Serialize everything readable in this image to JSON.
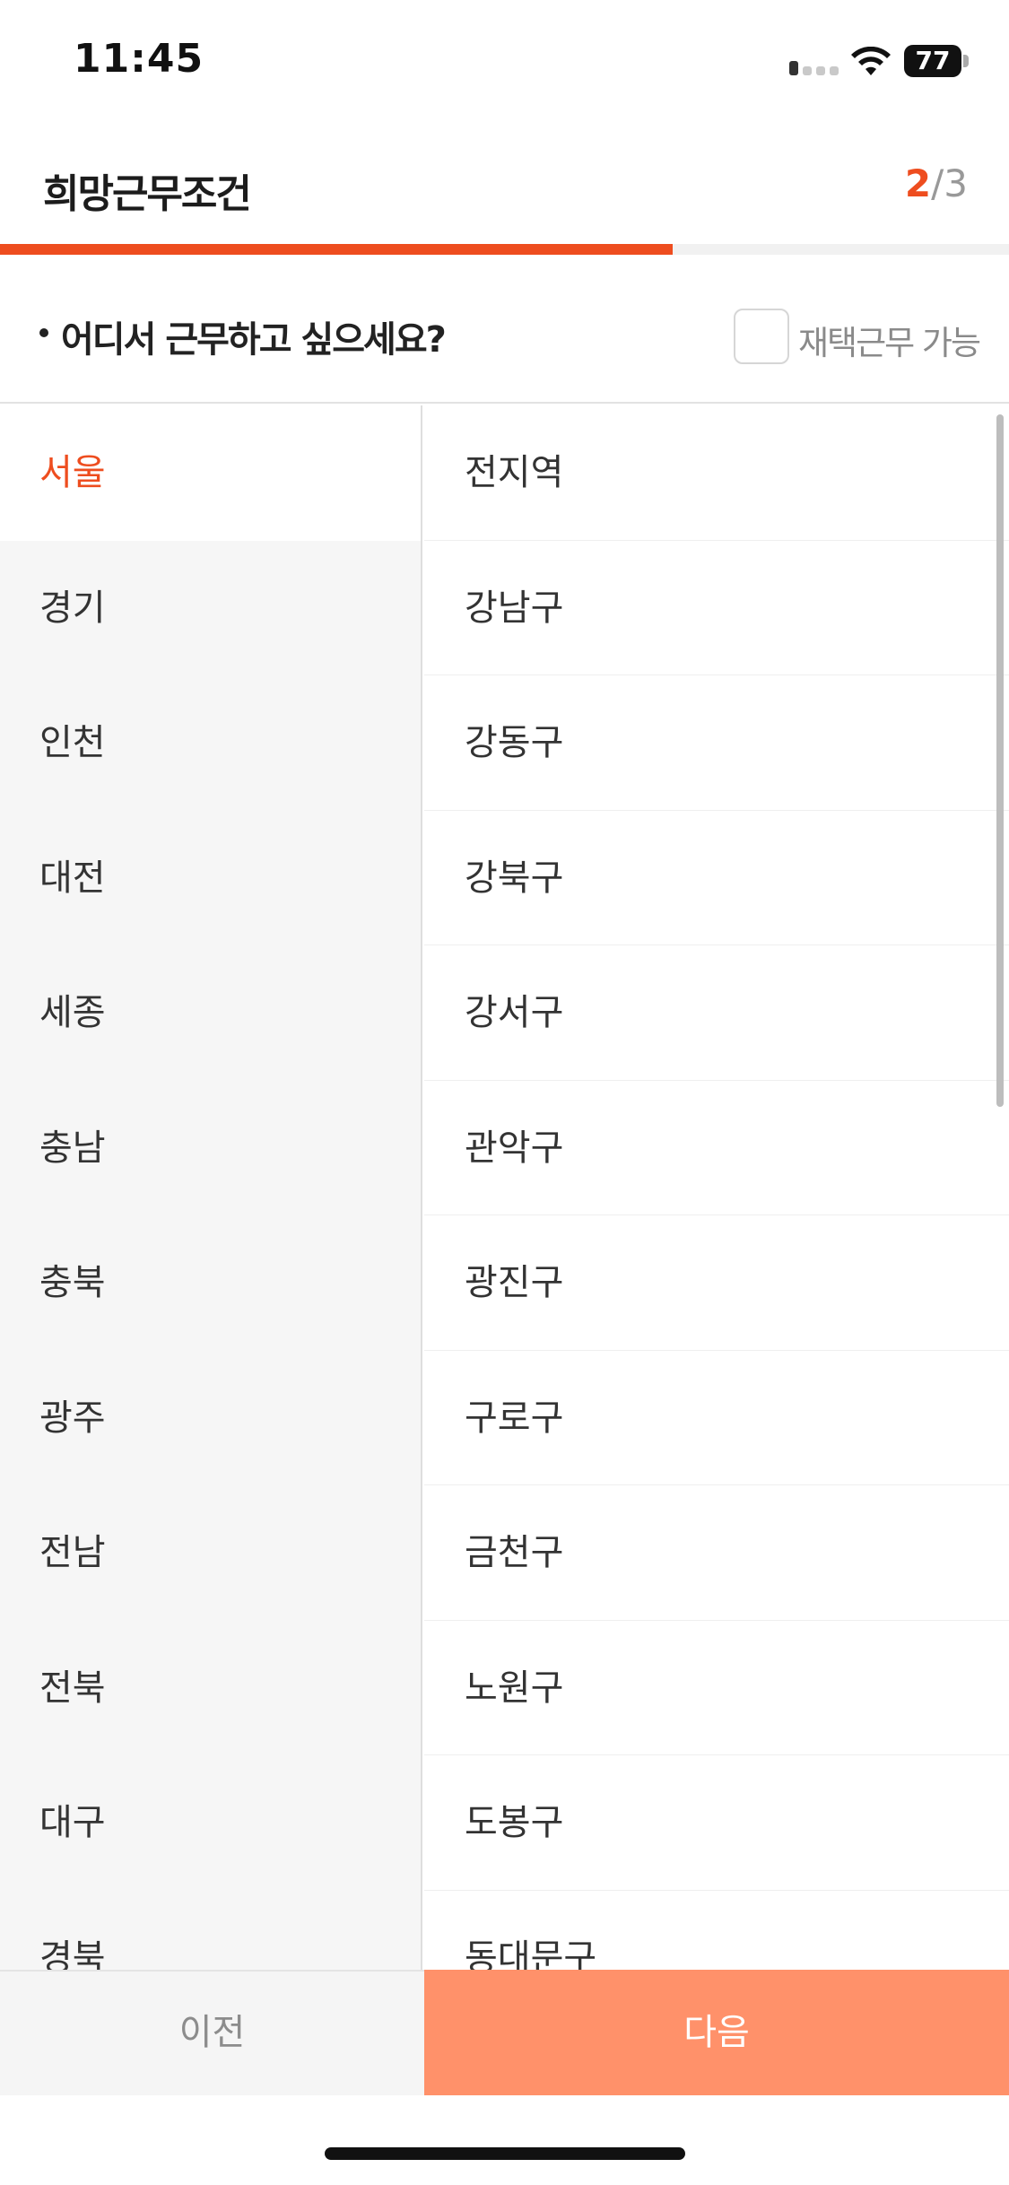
{
  "status_bar": {
    "time": "11:45",
    "battery": "77"
  },
  "header": {
    "title": "희망근무조건",
    "step_current": "2",
    "step_total": "/3"
  },
  "progress": {
    "fraction": 0.6667
  },
  "question": {
    "text": "어디서 근무하고 싶으세요?",
    "remote_label": "재택근무 가능",
    "remote_checked": false
  },
  "regions": [
    {
      "label": "서울",
      "selected": true
    },
    {
      "label": "경기"
    },
    {
      "label": "인천"
    },
    {
      "label": "대전"
    },
    {
      "label": "세종"
    },
    {
      "label": "충남"
    },
    {
      "label": "충북"
    },
    {
      "label": "광주"
    },
    {
      "label": "전남"
    },
    {
      "label": "전북"
    },
    {
      "label": "대구"
    },
    {
      "label": "경북"
    }
  ],
  "districts": [
    "전지역",
    "강남구",
    "강동구",
    "강북구",
    "강서구",
    "관악구",
    "광진구",
    "구로구",
    "금천구",
    "노원구",
    "도봉구",
    "동대문구"
  ],
  "footer": {
    "prev_label": "이전",
    "next_label": "다음"
  },
  "colors": {
    "accent": "#ee4d1f",
    "next_button": "#ff916a",
    "left_panel": "#f6f6f6"
  }
}
